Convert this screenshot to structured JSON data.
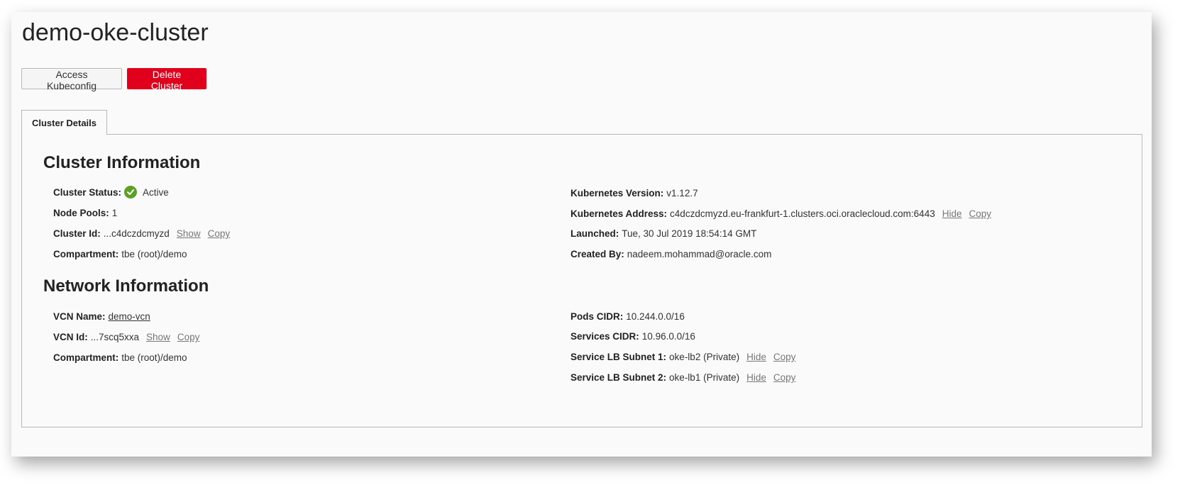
{
  "page": {
    "title": "demo-oke-cluster"
  },
  "toolbar": {
    "access_label": "Access Kubeconfig",
    "delete_label": "Delete Cluster"
  },
  "tabs": [
    {
      "label": "Cluster Details",
      "active": true
    }
  ],
  "cluster_info": {
    "heading": "Cluster Information",
    "status_label": "Cluster Status:",
    "status_value": "Active",
    "status_color": "#5da028",
    "node_pools_label": "Node Pools:",
    "node_pools_value": "1",
    "cluster_id_label": "Cluster Id:",
    "cluster_id_value": "...c4dczdcmyzd",
    "cluster_id_show": "Show",
    "cluster_id_copy": "Copy",
    "compartment_label": "Compartment:",
    "compartment_value": "tbe (root)/demo",
    "k8s_version_label": "Kubernetes Version:",
    "k8s_version_value": "v1.12.7",
    "k8s_address_label": "Kubernetes Address:",
    "k8s_address_value": "c4dczdcmyzd.eu-frankfurt-1.clusters.oci.oraclecloud.com:6443",
    "k8s_address_hide": "Hide",
    "k8s_address_copy": "Copy",
    "launched_label": "Launched:",
    "launched_value": "Tue, 30 Jul 2019 18:54:14 GMT",
    "created_by_label": "Created By:",
    "created_by_value": "nadeem.mohammad@oracle.com"
  },
  "network_info": {
    "heading": "Network Information",
    "vcn_name_label": "VCN Name:",
    "vcn_name_value": "demo-vcn",
    "vcn_id_label": "VCN Id:",
    "vcn_id_value": "...7scq5xxa",
    "vcn_id_show": "Show",
    "vcn_id_copy": "Copy",
    "compartment_label": "Compartment:",
    "compartment_value": "tbe (root)/demo",
    "pods_cidr_label": "Pods CIDR:",
    "pods_cidr_value": "10.244.0.0/16",
    "services_cidr_label": "Services CIDR:",
    "services_cidr_value": "10.96.0.0/16",
    "lb_subnet1_label": "Service LB Subnet 1:",
    "lb_subnet1_value": "oke-lb2 (Private)",
    "lb_subnet1_hide": "Hide",
    "lb_subnet1_copy": "Copy",
    "lb_subnet2_label": "Service LB Subnet 2:",
    "lb_subnet2_value": "oke-lb1 (Private)",
    "lb_subnet2_hide": "Hide",
    "lb_subnet2_copy": "Copy"
  },
  "colors": {
    "danger": "#e0001b",
    "link": "#1a73c9",
    "success": "#5da028"
  }
}
